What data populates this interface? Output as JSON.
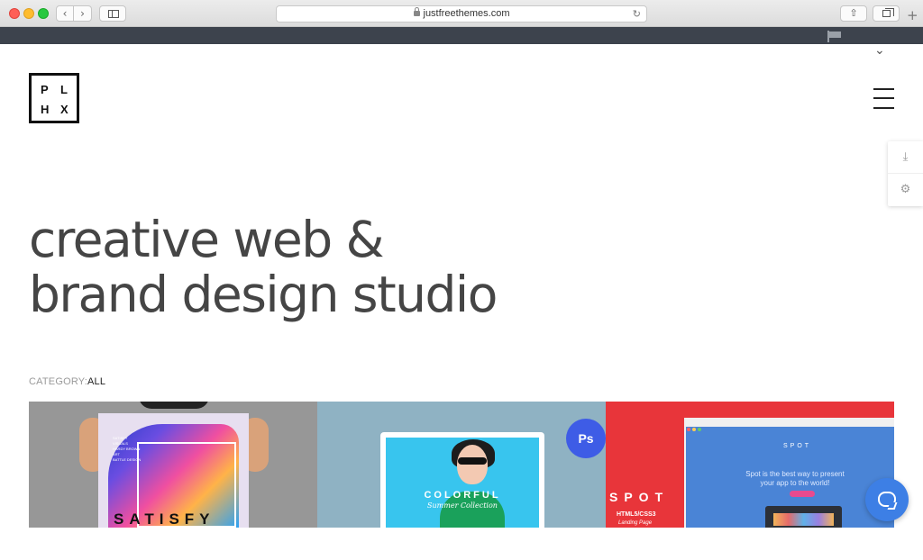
{
  "browser": {
    "url": "justfreethemes.com",
    "back_icon": "‹",
    "forward_icon": "›",
    "reload_icon": "↻",
    "share_icon": "⇧",
    "newtab_icon": "+"
  },
  "header": {
    "logo_letters": [
      "P",
      "L",
      "H",
      "X"
    ],
    "menu_icon": "hamburger-icon",
    "collapse_icon": "⌄"
  },
  "side_widget": {
    "download_icon": "⤓",
    "settings_icon": "⚙"
  },
  "hero": {
    "line1": "creative web &",
    "line2": "brand design studio"
  },
  "filter": {
    "label": "CATEGORY:",
    "value": "ALL"
  },
  "portfolio": {
    "items": [
      {
        "title": "SATISFY",
        "small_text": [
          "SATISFY",
          "VISUALS",
          "HARDY BROWN",
          "ART",
          "BATTLE DESIGN"
        ]
      },
      {
        "title": "COLORFUL",
        "subtitle": "Summer Collection",
        "badge": "Ps"
      },
      {
        "title": "SPOT",
        "tech": "HTML5/CSS3",
        "type": "Landing Page",
        "screen_logo": "SPOT",
        "screen_headline": "Spot is the best way to present your app to the world!"
      }
    ]
  },
  "colors": {
    "topbar": "#3d434d",
    "hero_text": "#454545",
    "chat_button": "#3d7fe5",
    "ps_badge": "#3e5ce6",
    "spot_red": "#e8353a"
  }
}
